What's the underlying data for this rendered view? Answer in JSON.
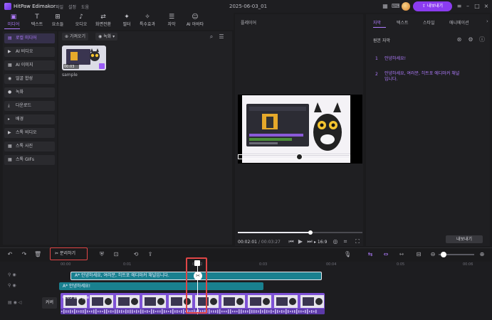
{
  "app": {
    "name": "HitPaw Edimakor",
    "project_title": "2025-06-03_01",
    "export_label": "내보내기"
  },
  "menu": [
    "파일",
    "설정",
    "도움"
  ],
  "toolbar": [
    {
      "label": "미디어",
      "icon": "media-icon",
      "glyph": "▣",
      "active": true
    },
    {
      "label": "텍스트",
      "icon": "text-icon",
      "glyph": "T",
      "active": false
    },
    {
      "label": "요소들",
      "icon": "elements-icon",
      "glyph": "⊞",
      "active": false
    },
    {
      "label": "오디오",
      "icon": "audio-icon",
      "glyph": "♪",
      "active": false
    },
    {
      "label": "화면전환",
      "icon": "transition-icon",
      "glyph": "⇄",
      "active": false
    },
    {
      "label": "필터",
      "icon": "filter-icon",
      "glyph": "✦",
      "active": false
    },
    {
      "label": "특수효과",
      "icon": "effects-icon",
      "glyph": "✧",
      "active": false
    },
    {
      "label": "자막",
      "icon": "subtitle-icon",
      "glyph": "☰",
      "active": false
    },
    {
      "label": "AI 아바타",
      "icon": "avatar-ai-icon",
      "glyph": "☺",
      "active": false
    }
  ],
  "sidebar": [
    {
      "label": "로컬 미디어",
      "glyph": "▤",
      "active": true
    },
    {
      "label": "AI 비디오",
      "glyph": "▶",
      "active": false
    },
    {
      "label": "AI 이미지",
      "glyph": "▦",
      "active": false
    },
    {
      "label": "얼굴 합성",
      "glyph": "◉",
      "active": false
    },
    {
      "label": "녹화",
      "glyph": "●",
      "active": false
    },
    {
      "label": "다운로드",
      "glyph": "⤓",
      "active": false
    },
    {
      "label": "배경",
      "glyph": "▸",
      "active": false
    },
    {
      "label": "스톡 비디오",
      "glyph": "▶",
      "active": false
    },
    {
      "label": "스톡 사진",
      "glyph": "▦",
      "active": false
    },
    {
      "label": "스톡 GIFs",
      "glyph": "▦",
      "active": false
    }
  ],
  "media": {
    "import_label": "가져오기",
    "record_label": "녹화",
    "item": {
      "duration": "00:03",
      "name": "sample"
    }
  },
  "player": {
    "label": "플레이어",
    "current_time": "00:02:01",
    "total_time": "/ 00:03:27",
    "aspect": "16:9",
    "progress": 0.58
  },
  "right_panel": {
    "tabs": [
      {
        "label": "자막",
        "active": true
      },
      {
        "label": "텍스트",
        "active": false
      },
      {
        "label": "스타일",
        "active": false
      },
      {
        "label": "애니메이션",
        "active": false
      }
    ],
    "section_title": "원본 자막",
    "subtitles": [
      {
        "num": "1",
        "text": "안녕하세요!"
      },
      {
        "num": "2",
        "text": "안녕하세요, 여러분, 히트포 에디마커 채널입니다."
      }
    ],
    "export_label": "내보내기"
  },
  "timeline": {
    "split_label": "분리하기",
    "ticks": [
      "00:00",
      "0:01",
      "00:02",
      "0:03",
      "00:04",
      "0:05",
      "00:06"
    ],
    "clip1_text": "A* 안녕하세요, 여러분, 히트포 에디마커 채널입니다.",
    "clip2_text": "A* 안녕하세요!",
    "clip3_label": "0:03 sample",
    "cover_label": "커버"
  },
  "colors": {
    "accent": "#8b3cf0",
    "subtitle_clip": "#19808f",
    "video_clip": "#7e52d6",
    "highlight": "#e04646"
  }
}
